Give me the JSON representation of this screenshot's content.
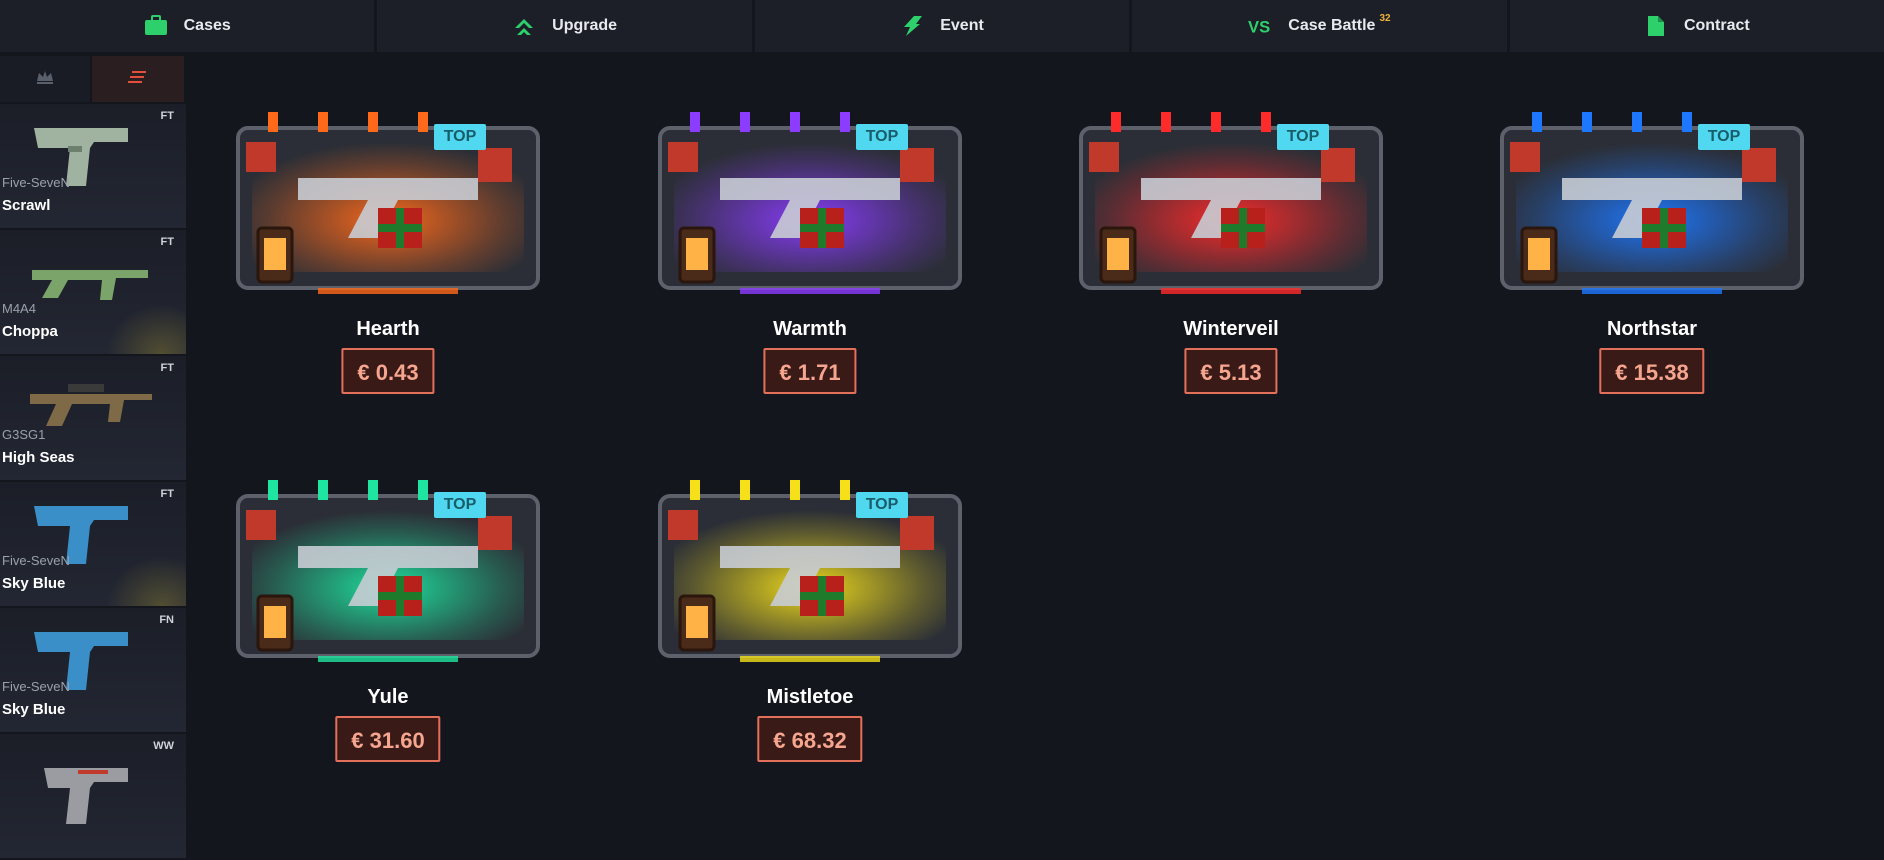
{
  "nav": [
    {
      "label": "Cases",
      "icon": "briefcase-icon",
      "badge": ""
    },
    {
      "label": "Upgrade",
      "icon": "upgrade-arrows-icon",
      "badge": ""
    },
    {
      "label": "Event",
      "icon": "lightning-icon",
      "badge": ""
    },
    {
      "label": "Case Battle",
      "icon": "vs-icon",
      "badge": "32"
    },
    {
      "label": "Contract",
      "icon": "document-icon",
      "badge": ""
    }
  ],
  "sidebar": {
    "tabs": [
      {
        "icon": "crown-icon"
      },
      {
        "icon": "stack-lines-icon"
      }
    ],
    "drops": [
      {
        "weapon": "Five-SeveN",
        "skin": "Scrawl",
        "condition": "FT",
        "color": "#9fb3a0"
      },
      {
        "weapon": "M4A4",
        "skin": "Choppa",
        "condition": "FT",
        "color": "#7aa46a"
      },
      {
        "weapon": "G3SG1",
        "skin": "High Seas",
        "condition": "FT",
        "color": "#7f6a48"
      },
      {
        "weapon": "Five-SeveN",
        "skin": "Sky Blue",
        "condition": "FT",
        "color": "#3a8fc8"
      },
      {
        "weapon": "Five-SeveN",
        "skin": "Sky Blue",
        "condition": "FN",
        "color": "#3a8fc8"
      },
      {
        "weapon": "",
        "skin": "",
        "condition": "WW",
        "color": "#9a9ca2"
      }
    ]
  },
  "cases": [
    {
      "name": "Hearth",
      "price": "€ 0.43",
      "badge": "TOP",
      "glow": "#ff6a1a"
    },
    {
      "name": "Warmth",
      "price": "€ 1.71",
      "badge": "TOP",
      "glow": "#8b3cff"
    },
    {
      "name": "Winterveil",
      "price": "€ 5.13",
      "badge": "TOP",
      "glow": "#ff2a2a"
    },
    {
      "name": "Northstar",
      "price": "€ 15.38",
      "badge": "TOP",
      "glow": "#1e78ff"
    },
    {
      "name": "Yule",
      "price": "€ 31.60",
      "badge": "TOP",
      "glow": "#1ee6a0"
    },
    {
      "name": "Mistletoe",
      "price": "€ 68.32",
      "badge": "TOP",
      "glow": "#f5e01a"
    }
  ],
  "colors": {
    "accent_green": "#2ed06b",
    "price_border": "#e2705a",
    "badge_bg": "#4fd8ef"
  }
}
